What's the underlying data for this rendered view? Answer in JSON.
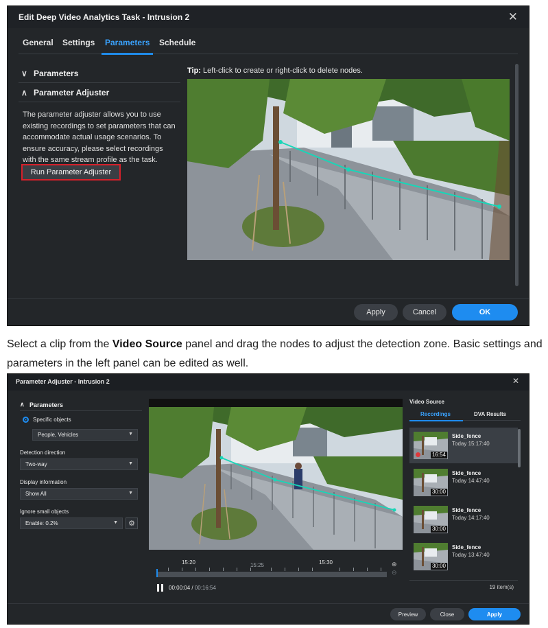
{
  "window1": {
    "title": "Edit Deep Video Analytics Task - Intrusion 2",
    "close_icon": "✕",
    "tabs": [
      {
        "label": "General",
        "active": false
      },
      {
        "label": "Settings",
        "active": false
      },
      {
        "label": "Parameters",
        "active": true
      },
      {
        "label": "Schedule",
        "active": false
      }
    ],
    "sections": {
      "parameters": "Parameters",
      "adjuster": "Parameter Adjuster"
    },
    "description": "The parameter adjuster allows you to use existing recordings to set parameters that can accommodate actual usage scenarios. To ensure accuracy, please select recordings with the same stream profile as the task.",
    "run_button": "Run Parameter Adjuster",
    "tip_label": "Tip:",
    "tip_text": " Left-click to create or right-click to delete nodes.",
    "footer": {
      "apply": "Apply",
      "cancel": "Cancel",
      "ok": "OK"
    }
  },
  "caption": {
    "before": "Select a clip from the ",
    "bold": "Video Source",
    "after": " panel and drag the nodes to adjust the detection zone. Basic settings and parameters in the left panel can be edited as well."
  },
  "window2": {
    "title": "Parameter Adjuster - Intrusion 2",
    "close_icon": "✕",
    "section": "Parameters",
    "radio_label": "Specific objects",
    "objects_value": "People, Vehicles",
    "detection_direction_label": "Detection direction",
    "detection_direction_value": "Two-way",
    "display_info_label": "Display information",
    "display_info_value": "Show All",
    "ignore_small_label": "Ignore small objects",
    "ignore_small_value": "Enable: 0.2%",
    "timeline": {
      "labels": [
        "15:20",
        "15:25",
        "15:30"
      ],
      "current": "00:00:04",
      "separator": " / ",
      "total": "00:16:54"
    },
    "video_source": {
      "header": "Video Source",
      "tabs": [
        "Recordings",
        "DVA Results"
      ],
      "recordings": [
        {
          "name": "Side_fence",
          "time": "Today 15:17:40",
          "duration": "16:54",
          "selected": true
        },
        {
          "name": "Side_fence",
          "time": "Today 14:47:40",
          "duration": "30:00",
          "selected": false
        },
        {
          "name": "Side_fence",
          "time": "Today 14:17:40",
          "duration": "30:00",
          "selected": false
        },
        {
          "name": "Side_fence",
          "time": "Today 13:47:40",
          "duration": "30:00",
          "selected": false
        }
      ],
      "count": "19 item(s)"
    },
    "footer": {
      "preview": "Preview",
      "close": "Close",
      "apply": "Apply"
    }
  },
  "colors": {
    "accent": "#1e8cf0",
    "dialog_bg": "#232629",
    "highlight_border": "#d6202a",
    "zone_line": "#18d6b8"
  }
}
